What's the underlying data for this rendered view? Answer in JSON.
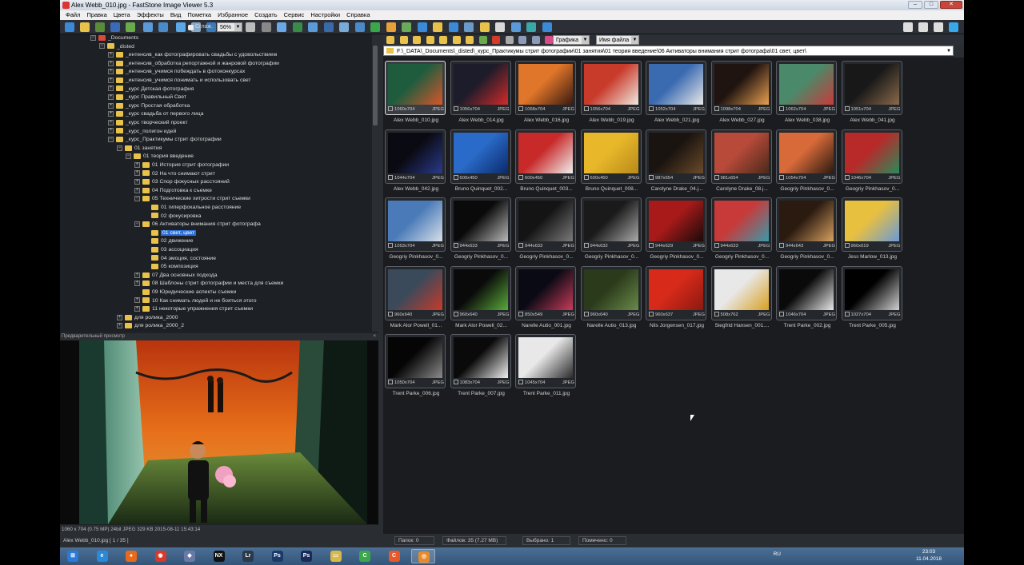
{
  "window": {
    "title": "Alex Webb_010.jpg  -  FastStone Image Viewer 5.3",
    "controls": [
      "–",
      "□",
      "✕"
    ]
  },
  "menu": [
    "Файл",
    "Правка",
    "Цвета",
    "Эффекты",
    "Вид",
    "Пометка",
    "Избранное",
    "Создать",
    "Сервис",
    "Настройки",
    "Справка"
  ],
  "toolbar": {
    "smooth_label": "Сглаж.",
    "zoom_value": "56%"
  },
  "nav": {
    "view_mode": "Графика",
    "sort_mode": "Имя файла"
  },
  "path": "F:\\_DATA\\_Documents\\_disted\\_курс_Практикумы стрит фотографии\\01 занятия\\01 теория введение\\06 Активаторы внимания стрит фотографа\\01 свет, цвет\\",
  "tree": [
    {
      "label": "_Documents",
      "level": 0,
      "exp": "−",
      "icon": "red"
    },
    {
      "label": "_disted",
      "level": 1,
      "exp": "−"
    },
    {
      "label": "_интенсив_как фотографировать свадьбы с удовольствием",
      "level": 2,
      "exp": "+"
    },
    {
      "label": "_интенсив_обработка репортажной и жанровой фотографии",
      "level": 2,
      "exp": "+"
    },
    {
      "label": "_интенсив_учимся побеждать в фотоконкурсах",
      "level": 2,
      "exp": "+"
    },
    {
      "label": "_интенсив_учимся понимать и использовать свет",
      "level": 2,
      "exp": "+"
    },
    {
      "label": "_курс Детская фотография",
      "level": 2,
      "exp": "+"
    },
    {
      "label": "_курс Правильный Свет",
      "level": 2,
      "exp": "+"
    },
    {
      "label": "_курс Простая обработка",
      "level": 2,
      "exp": "+"
    },
    {
      "label": "_курс свадьба от первого лица",
      "level": 2,
      "exp": "+"
    },
    {
      "label": "_курс творческий проект",
      "level": 2,
      "exp": "+"
    },
    {
      "label": "_курс_полигон идей",
      "level": 2,
      "exp": "+"
    },
    {
      "label": "_курс_Практикумы стрит фотографии",
      "level": 2,
      "exp": "−"
    },
    {
      "label": "01 занятия",
      "level": 3,
      "exp": "−"
    },
    {
      "label": "01 теория введение",
      "level": 4,
      "exp": "−"
    },
    {
      "label": "01 История стрит фотографии",
      "level": 5,
      "exp": "+"
    },
    {
      "label": "02 На что снимают стрит",
      "level": 5,
      "exp": "+"
    },
    {
      "label": "03 Спор фокусных расстояний",
      "level": 5,
      "exp": "+"
    },
    {
      "label": "04 Подготовка к съемке",
      "level": 5,
      "exp": "+"
    },
    {
      "label": "05 Технические хитрости стрит съемки",
      "level": 5,
      "exp": "−"
    },
    {
      "label": "01 гиперфокальное расстояние",
      "level": 6,
      "exp": ""
    },
    {
      "label": "02 фокусировка",
      "level": 6,
      "exp": ""
    },
    {
      "label": "06 Активаторы внимания стрит фотографа",
      "level": 5,
      "exp": "−"
    },
    {
      "label": "01 свет, цвет",
      "level": 6,
      "exp": "",
      "selected": true
    },
    {
      "label": "02 движение",
      "level": 6,
      "exp": ""
    },
    {
      "label": "03 ассоциация",
      "level": 6,
      "exp": ""
    },
    {
      "label": "04 эмоция, состояние",
      "level": 6,
      "exp": ""
    },
    {
      "label": "05 композиция",
      "level": 6,
      "exp": ""
    },
    {
      "label": "07 Два основных подхода",
      "level": 5,
      "exp": "+"
    },
    {
      "label": "08 Шаблоны стрит фотографии и места для съемки",
      "level": 5,
      "exp": "+"
    },
    {
      "label": "09 Юридические аспекты съемки",
      "level": 5,
      "exp": ""
    },
    {
      "label": "10 Как снимать людей и не бояться этого",
      "level": 5,
      "exp": "+"
    },
    {
      "label": "11 некоторые упражнения стрит съемки",
      "level": 5,
      "exp": "+"
    },
    {
      "label": "для ролика_2000",
      "level": 3,
      "exp": "+"
    },
    {
      "label": "для ролика_2000_2",
      "level": 3,
      "exp": "+"
    }
  ],
  "preview": {
    "header": "Предварительный просмотр",
    "status": "1060 x 704 (0.75 MP)  24bit  JPEG   329 KB   2015-08-11 15:43:14"
  },
  "thumbs": [
    {
      "name": "Alex Webb_010.jpg",
      "dims": "1060x704",
      "fmt": "JPEG",
      "c1": "#1f5c3e",
      "c2": "#d8562a",
      "selected": true
    },
    {
      "name": "Alex Webb_014.jpg",
      "dims": "1056x704",
      "fmt": "JPEG",
      "c1": "#1c1c2a",
      "c2": "#d42a2a"
    },
    {
      "name": "Alex Webb_016.jpg",
      "dims": "1068x704",
      "fmt": "JPEG",
      "c1": "#e0762a",
      "c2": "#3a1a10"
    },
    {
      "name": "Alex Webb_019.jpg",
      "dims": "1056x704",
      "fmt": "JPEG",
      "c1": "#c83a2a",
      "c2": "#f0e8e0"
    },
    {
      "name": "Alex Webb_021.jpg",
      "dims": "1052x704",
      "fmt": "JPEG",
      "c1": "#3a6ab0",
      "c2": "#e8e8e8"
    },
    {
      "name": "Alex Webb_027.jpg",
      "dims": "1098x704",
      "fmt": "JPEG",
      "c1": "#201410",
      "c2": "#e8a050"
    },
    {
      "name": "Alex Webb_038.jpg",
      "dims": "1062x704",
      "fmt": "JPEG",
      "c1": "#4a8a6a",
      "c2": "#c83a3a"
    },
    {
      "name": "Alex Webb_041.jpg",
      "dims": "1051x704",
      "fmt": "JPEG",
      "c1": "#181818",
      "c2": "#8a6a4a"
    },
    {
      "name": "Alex Webb_042.jpg",
      "dims": "1044x704",
      "fmt": "JPEG",
      "c1": "#0a0a12",
      "c2": "#2a3a8a"
    },
    {
      "name": "Bruno Quinquet_002...",
      "dims": "600x450",
      "fmt": "JPEG",
      "c1": "#2a6ac8",
      "c2": "#0a2a6a"
    },
    {
      "name": "Bruno Quinquet_003...",
      "dims": "600x450",
      "fmt": "JPEG",
      "c1": "#c82a2a",
      "c2": "#f0f0f0"
    },
    {
      "name": "Bruno Quinquet_008...",
      "dims": "600x450",
      "fmt": "JPEG",
      "c1": "#e8b82a",
      "c2": "#b88a1a"
    },
    {
      "name": "Carolyne Drake_04.j...",
      "dims": "987x654",
      "fmt": "JPEG",
      "c1": "#1a1410",
      "c2": "#6a4a2a"
    },
    {
      "name": "Carolyne Drake_08.j...",
      "dims": "981x654",
      "fmt": "JPEG",
      "c1": "#b84a3a",
      "c2": "#4a2a1a"
    },
    {
      "name": "Geogriy Pinkhasov_0...",
      "dims": "1054x704",
      "fmt": "JPEG",
      "c1": "#d86a3a",
      "c2": "#2a1a10"
    },
    {
      "name": "Geogriy Pinkhasov_0...",
      "dims": "1046x704",
      "fmt": "JPEG",
      "c1": "#b82a2a",
      "c2": "#2a8a5a"
    },
    {
      "name": "Geogriy Pinkhasov_0...",
      "dims": "1053x704",
      "fmt": "JPEG",
      "c1": "#4a7ab8",
      "c2": "#d8e0e8"
    },
    {
      "name": "Geogriy Pinkhasov_0...",
      "dims": "944x633",
      "fmt": "JPEG",
      "c1": "#0a0a0a",
      "c2": "#b8b8b8"
    },
    {
      "name": "Geogriy Pinkhasov_0...",
      "dims": "944x633",
      "fmt": "JPEG",
      "c1": "#141414",
      "c2": "#7a7a7a"
    },
    {
      "name": "Geogriy Pinkhasov_0...",
      "dims": "944x632",
      "fmt": "JPEG",
      "c1": "#1a1a1a",
      "c2": "#aaaaaa"
    },
    {
      "name": "Geogriy Pinkhasov_0...",
      "dims": "944x629",
      "fmt": "JPEG",
      "c1": "#a81a1a",
      "c2": "#1a0a0a"
    },
    {
      "name": "Geogriy Pinkhasov_0...",
      "dims": "944x633",
      "fmt": "JPEG",
      "c1": "#c83a3a",
      "c2": "#3a9aaa"
    },
    {
      "name": "Geogriy Pinkhasov_0...",
      "dims": "944x643",
      "fmt": "JPEG",
      "c1": "#2a1a10",
      "c2": "#d8a060"
    },
    {
      "name": "Jess Marlow_013.jpg",
      "dims": "960x619",
      "fmt": "JPEG",
      "c1": "#e8c040",
      "c2": "#6a9ad8"
    },
    {
      "name": "Mark Alor Powell_01...",
      "dims": "960x640",
      "fmt": "JPEG",
      "c1": "#3a4a5a",
      "c2": "#c83a2a"
    },
    {
      "name": "Mark Alor Powell_02...",
      "dims": "960x640",
      "fmt": "JPEG",
      "c1": "#0a0a0a",
      "c2": "#5aaa3a"
    },
    {
      "name": "Narelle Autio_001.jpg",
      "dims": "850x549",
      "fmt": "JPEG",
      "c1": "#0a0a14",
      "c2": "#c83a5a"
    },
    {
      "name": "Narelle Autio_013.jpg",
      "dims": "960x640",
      "fmt": "JPEG",
      "c1": "#2a3a1a",
      "c2": "#6a8a4a"
    },
    {
      "name": "Nils Jorgensen_017.jpg",
      "dims": "960x637",
      "fmt": "JPEG",
      "c1": "#d82a1a",
      "c2": "#8a1a10"
    },
    {
      "name": "Siegfrid Hansen_001....",
      "dims": "508x762",
      "fmt": "JPEG",
      "c1": "#e8e8e8",
      "c2": "#d8a020"
    },
    {
      "name": "Trent Parke_002.jpg",
      "dims": "1046x704",
      "fmt": "JPEG",
      "c1": "#0a0a0a",
      "c2": "#e8e8e8"
    },
    {
      "name": "Trent Parke_005.jpg",
      "dims": "1027x704",
      "fmt": "JPEG",
      "c1": "#000000",
      "c2": "#d0d0d0"
    },
    {
      "name": "Trent Parke_006.jpg",
      "dims": "1050x704",
      "fmt": "JPEG",
      "c1": "#050505",
      "c2": "#8a8a8a"
    },
    {
      "name": "Trent Parke_007.jpg",
      "dims": "1083x704",
      "fmt": "JPEG",
      "c1": "#0a0a0a",
      "c2": "#f0f0f0"
    },
    {
      "name": "Trent Parke_011.jpg",
      "dims": "1045x704",
      "fmt": "JPEG",
      "c1": "#e8e8e8",
      "c2": "#2a2a2a"
    }
  ],
  "status": {
    "file": "Alex Webb_010.jpg [ 1 / 35 ]",
    "folders": "Папок: 0",
    "files": "Файлов: 35 (7.27 MB)",
    "selected": "Выбрано: 1",
    "marked": "Помечено: 0"
  },
  "taskbar": {
    "apps": [
      {
        "name": "start",
        "color": "#2a7ad8",
        "glyph": "⊞"
      },
      {
        "name": "ie",
        "color": "#2a8ad8",
        "glyph": "e"
      },
      {
        "name": "firefox",
        "color": "#e86a1a",
        "glyph": "●"
      },
      {
        "name": "chrome",
        "color": "#d83a2a",
        "glyph": "◉"
      },
      {
        "name": "app5",
        "color": "#6a7aa8",
        "glyph": "◆"
      },
      {
        "name": "nx2",
        "color": "#111111",
        "glyph": "NX"
      },
      {
        "name": "lightroom",
        "color": "#2a3a4a",
        "glyph": "Lr"
      },
      {
        "name": "photoshop",
        "color": "#1a3a6a",
        "glyph": "Ps"
      },
      {
        "name": "photoshop2",
        "color": "#1a2a5a",
        "glyph": "Ps"
      },
      {
        "name": "explorer",
        "color": "#d8b84a",
        "glyph": "▭"
      },
      {
        "name": "camtasia",
        "color": "#3aa84a",
        "glyph": "C"
      },
      {
        "name": "recorder",
        "color": "#e8582a",
        "glyph": "C"
      },
      {
        "name": "faststone",
        "color": "#e88a2a",
        "glyph": "◎"
      }
    ],
    "lang": "RU",
    "time": "23:03",
    "date": "11.04.2018"
  }
}
